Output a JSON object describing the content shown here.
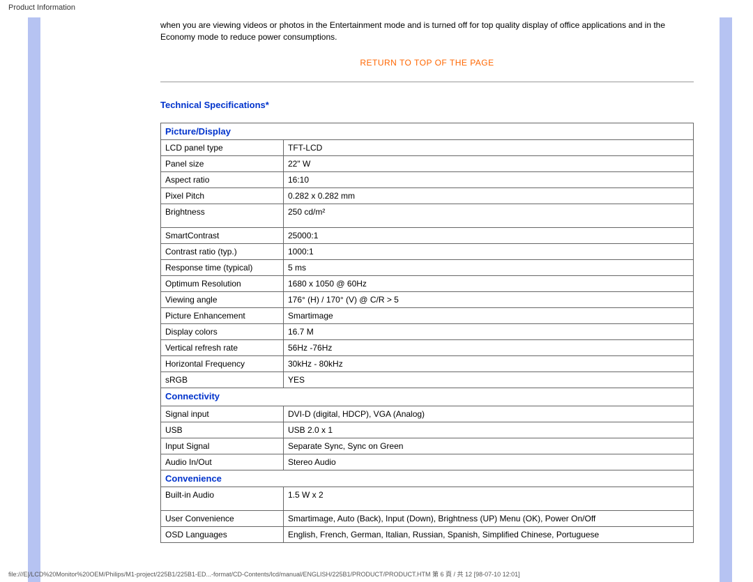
{
  "header": {
    "title": "Product Information"
  },
  "intro": {
    "text": "when you are viewing videos or photos in the Entertainment mode and is turned off for top quality display of office applications and in the Economy mode to reduce power consumptions."
  },
  "links": {
    "return_top": "RETURN TO TOP OF THE PAGE"
  },
  "section": {
    "title": "Technical Specifications*"
  },
  "spec": {
    "picture_display": {
      "header": "Picture/Display",
      "rows": [
        {
          "label": "LCD panel type",
          "value": "TFT-LCD"
        },
        {
          "label": "Panel size",
          "value": "22\" W"
        },
        {
          "label": "Aspect ratio",
          "value": "16:10"
        },
        {
          "label": "Pixel Pitch",
          "value": "0.282 x 0.282 mm"
        },
        {
          "label": "Brightness",
          "value": "250 cd/m²"
        },
        {
          "label": "SmartContrast",
          "value": "25000:1"
        },
        {
          "label": "Contrast ratio (typ.)",
          "value": "1000:1"
        },
        {
          "label": "Response time (typical)",
          "value": "5 ms"
        },
        {
          "label": "Optimum Resolution",
          "value": "1680 x 1050 @ 60Hz"
        },
        {
          "label": "Viewing angle",
          "value": "176° (H) / 170° (V) @ C/R > 5"
        },
        {
          "label": "Picture Enhancement",
          "value": "Smartimage"
        },
        {
          "label": "Display colors",
          "value": "16.7 M"
        },
        {
          "label": "Vertical refresh rate",
          "value": "56Hz -76Hz"
        },
        {
          "label": "Horizontal Frequency",
          "value": "30kHz - 80kHz"
        },
        {
          "label": "sRGB",
          "value": "YES"
        }
      ]
    },
    "connectivity": {
      "header": "Connectivity",
      "rows": [
        {
          "label": "Signal input",
          "value": "DVI-D (digital, HDCP), VGA (Analog)"
        },
        {
          "label": "USB",
          "value": "USB 2.0 x 1"
        },
        {
          "label": "Input Signal",
          "value": "Separate Sync, Sync on Green"
        },
        {
          "label": "Audio In/Out",
          "value": "Stereo Audio"
        }
      ]
    },
    "convenience": {
      "header": "Convenience",
      "rows": [
        {
          "label": "Built-in Audio",
          "value": "1.5 W x 2"
        },
        {
          "label": "User Convenience",
          "value": "Smartimage, Auto (Back), Input (Down), Brightness (UP) Menu (OK), Power On/Off"
        },
        {
          "label": "OSD Languages",
          "value": "English, French, German, Italian, Russian, Spanish, Simplified Chinese, Portuguese"
        }
      ]
    }
  },
  "footer": {
    "path": "file:///E|/LCD%20Monitor%20OEM/Philips/M1-project/225B1/225B1-ED...-format/CD-Contents/lcd/manual/ENGLISH/225B1/PRODUCT/PRODUCT.HTM 第 6 頁 / 共 12  [98-07-10 12:01]"
  }
}
